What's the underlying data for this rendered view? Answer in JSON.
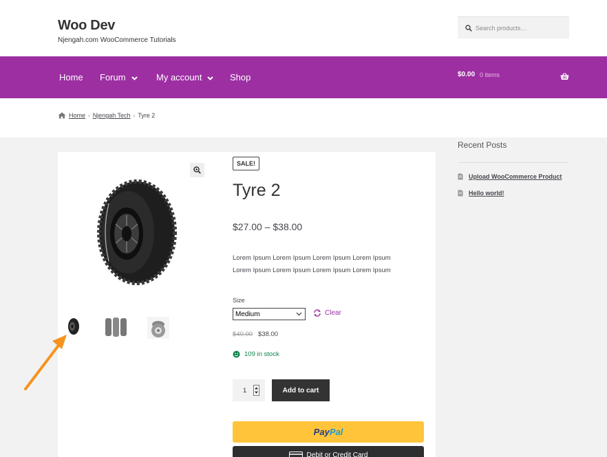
{
  "site": {
    "title": "Woo Dev",
    "description": "Njengah.com WooCommerce Tutorials"
  },
  "search": {
    "placeholder": "Search products…",
    "icon": "search-icon"
  },
  "nav": {
    "items": [
      {
        "label": "Home",
        "has_dropdown": false
      },
      {
        "label": "Forum",
        "has_dropdown": true
      },
      {
        "label": "My account",
        "has_dropdown": true
      },
      {
        "label": "Shop",
        "has_dropdown": false
      }
    ],
    "cart_amount": "$0.00",
    "cart_items": "0 items",
    "color": "#9d2fa3"
  },
  "breadcrumb": {
    "items": [
      "Home",
      "Njengah Tech"
    ],
    "current": "Tyre 2"
  },
  "product": {
    "badge": "SALE!",
    "title": "Tyre 2",
    "price_range": "$27.00 – $38.00",
    "description_line1": "Lorem Ipsum  Lorem Ipsum Lorem Ipsum Lorem Ipsum",
    "description_line2": "Lorem Ipsum Lorem Ipsum Lorem Ipsum Lorem Ipsum",
    "size_label": "Size",
    "size_selected": "Medium",
    "clear_label": "Clear",
    "old_price": "$40.00",
    "new_price": "$38.00",
    "stock": "109 in stock",
    "quantity": "1",
    "add_to_cart": "Add to cart",
    "paypal_label_1": "Pay",
    "paypal_label_2": "Pal",
    "debit_label": "Debit or Credit Card",
    "thumbnails": [
      "tyre-thumb-1",
      "tyre-thumb-2",
      "tyre-thumb-3"
    ]
  },
  "sidebar": {
    "title": "Recent Posts",
    "posts": [
      "Upload WooCommerce Product",
      "Hello world!"
    ]
  },
  "annotation": {
    "arrow_color": "#f7931e"
  }
}
